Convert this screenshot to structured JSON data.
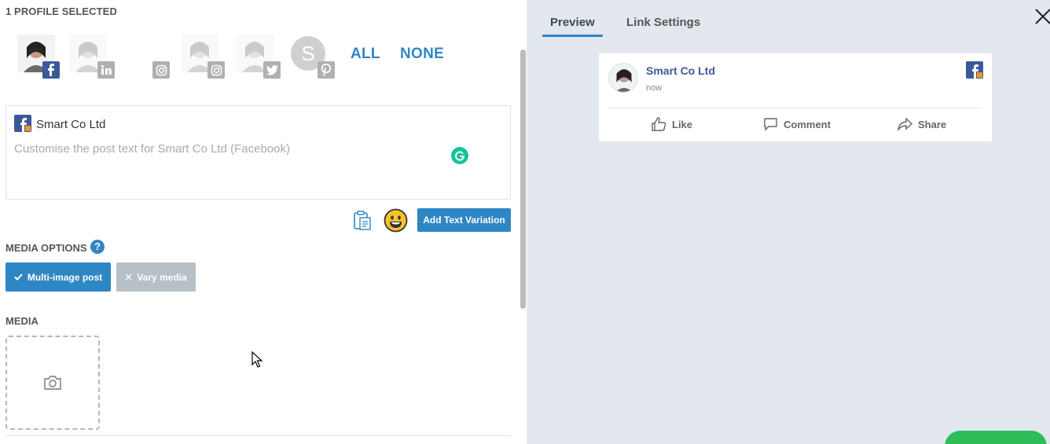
{
  "left": {
    "profiles_header": "1 PROFILE SELECTED",
    "select_all": "ALL",
    "select_none": "NONE",
    "profiles": [
      {
        "network": "facebook",
        "badge_icon": "facebook-icon",
        "selected": true
      },
      {
        "network": "linkedin",
        "badge_icon": "linkedin-icon",
        "selected": false
      },
      {
        "network": "instagram",
        "badge_icon": "instagram-icon",
        "selected": false
      },
      {
        "network": "instagram",
        "badge_icon": "instagram-icon",
        "selected": false
      },
      {
        "network": "twitter",
        "badge_icon": "twitter-icon",
        "selected": false
      },
      {
        "network": "pinterest",
        "badge_icon": "pinterest-icon",
        "selected": false,
        "initial": "S"
      }
    ],
    "post": {
      "profile_name": "Smart Co Ltd",
      "placeholder": "Customise the post text for Smart Co Ltd (Facebook)",
      "value": ""
    },
    "tools": {
      "add_variation_label": "Add Text Variation"
    },
    "media_options": {
      "label": "MEDIA OPTIONS",
      "help": "?",
      "multi_image_label": "Multi-image post",
      "vary_media_label": "Vary media"
    },
    "media": {
      "label": "MEDIA"
    }
  },
  "right": {
    "tabs": [
      {
        "label": "Preview",
        "active": true
      },
      {
        "label": "Link Settings",
        "active": false
      }
    ],
    "preview": {
      "name": "Smart Co Ltd",
      "time": "now",
      "actions": [
        {
          "label": "Like",
          "icon": "like-icon"
        },
        {
          "label": "Comment",
          "icon": "comment-icon"
        },
        {
          "label": "Share",
          "icon": "share-icon"
        }
      ]
    }
  },
  "colors": {
    "accent": "#2f86c4",
    "facebook": "#3b5998",
    "preview_bg": "#e2e8ee",
    "disabled": "#b6c0c6",
    "success": "#2ebd59"
  }
}
